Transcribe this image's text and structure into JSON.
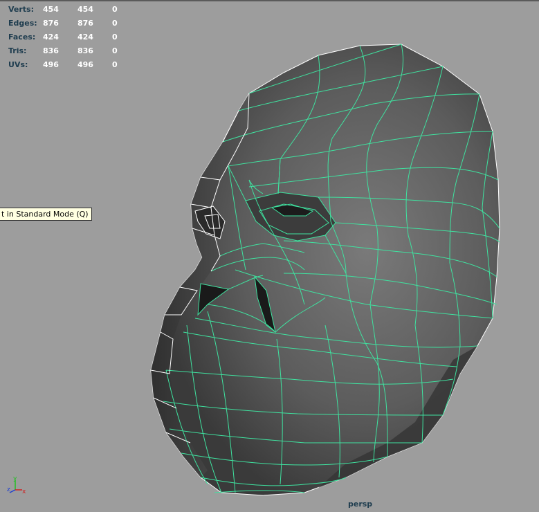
{
  "hud": {
    "rows": [
      {
        "label": "Verts:",
        "a": "454",
        "b": "454",
        "c": "0"
      },
      {
        "label": "Edges:",
        "a": "876",
        "b": "876",
        "c": "0"
      },
      {
        "label": "Faces:",
        "a": "424",
        "b": "424",
        "c": "0"
      },
      {
        "label": "Tris:",
        "a": "836",
        "b": "836",
        "c": "0"
      },
      {
        "label": "UVs:",
        "a": "496",
        "b": "496",
        "c": "0"
      }
    ]
  },
  "tooltip": {
    "text": "t in Standard Mode (Q)"
  },
  "viewport": {
    "camera": "persp"
  },
  "axis": {
    "y": "y",
    "z": "z",
    "x": "x"
  },
  "colors": {
    "background": "#9d9d9d",
    "wireframe": "#3fe3a0",
    "mesh_fill": "#5b5b5b",
    "hud_label": "#1e3c4e"
  },
  "icons": [
    "axis-gizmo-icon"
  ]
}
